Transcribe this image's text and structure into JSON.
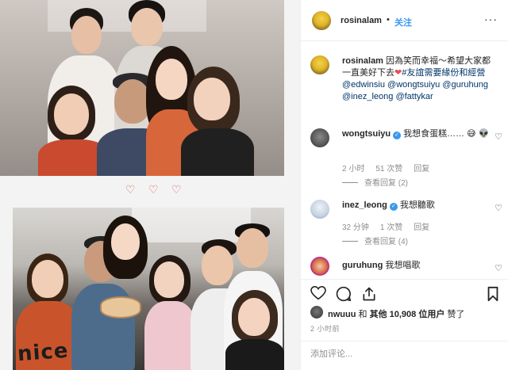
{
  "header": {
    "avatar_icon": "profile-avatar",
    "username": "rosinalam",
    "separator": "•",
    "follow_label": "关注",
    "more_icon": "more-options-icon",
    "more_glyph": "···"
  },
  "caption": {
    "username": "rosinalam",
    "text_1": "因為笑而幸福～希望大家都一直美好下去",
    "heart": "❤",
    "hashtag": "#友誼需要緣份和經營",
    "mentions": [
      "@edwinsiu",
      "@wongtsuiyu",
      "@guruhung",
      "@inez_leong",
      "@fattykar"
    ]
  },
  "comments": [
    {
      "username": "wongtsuiyu",
      "text": "我想食蛋糕……",
      "emoji": "😅 👽",
      "time": "2 小时",
      "likes": "51 次赞",
      "reply": "回复",
      "view_replies": "查看回复 (2)"
    },
    {
      "username": "inez_leong",
      "text": "我想聽歌",
      "time": "32 分钟",
      "likes": "1 次赞",
      "reply": "回复",
      "view_replies": "查看回复 (4)"
    },
    {
      "username": "guruhung",
      "text": "我想唱歌"
    }
  ],
  "likes_row": {
    "first_liker": "nwuuu",
    "and": "和",
    "others": "其他 10,908 位用户",
    "suffix": "赞了"
  },
  "post_time": "2 小时前",
  "add_comment": {
    "placeholder": "添加评论..."
  },
  "icons": {
    "verified_glyph": "✓",
    "comment_like": "♡",
    "photo_hearts": "♡ ♡ ♡"
  },
  "photo_text": {
    "nice": "nice"
  },
  "colors": {
    "link": "#3897f0",
    "mention": "#003569",
    "heart": "#ed4956",
    "meta": "#8e8e8e"
  }
}
